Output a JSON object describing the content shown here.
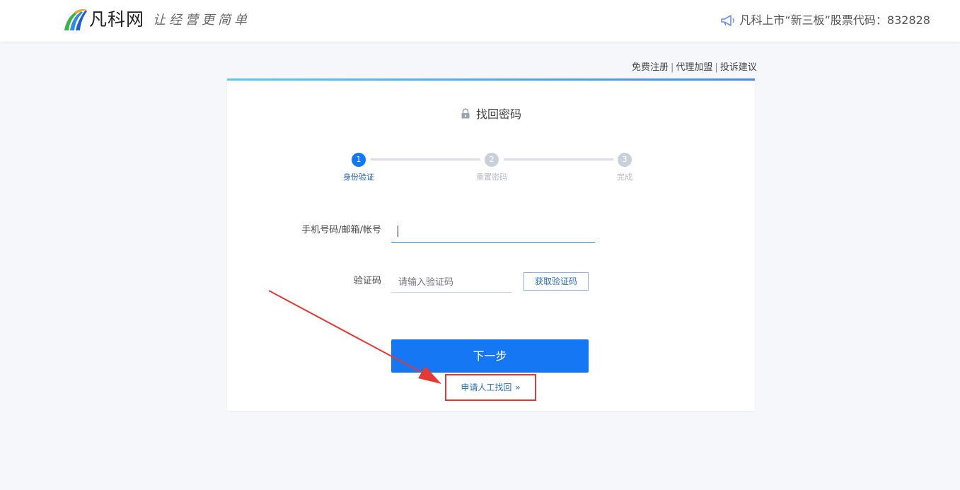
{
  "header": {
    "brand": "凡科网",
    "slogan": "让经营更简单",
    "listing": "凡科上市“新三板”股票代码：832828",
    "logo_icon": "fanke-logo-icon",
    "megaphone_icon": "megaphone-icon"
  },
  "top_links": {
    "register": "免费注册",
    "agent": "代理加盟",
    "complaint": "投诉建议",
    "separator": "|"
  },
  "card": {
    "title": "找回密码",
    "lock_icon": "lock-icon",
    "steps": [
      {
        "number": "1",
        "label": "身份验证"
      },
      {
        "number": "2",
        "label": "重置密码"
      },
      {
        "number": "3",
        "label": "完成"
      }
    ],
    "account_label": "手机号码/邮箱/帐号",
    "account_value": "",
    "code_label": "验证码",
    "code_placeholder": "请输入验证码",
    "get_code_button": "获取验证码",
    "next_button": "下一步",
    "manual_link": "申请人工找回",
    "manual_chevron": "»"
  },
  "colors": {
    "accent": "#1677f5",
    "step_inactive": "#c9d0da",
    "highlight_box": "#e53935",
    "annotation_arrow": "#e53935"
  }
}
